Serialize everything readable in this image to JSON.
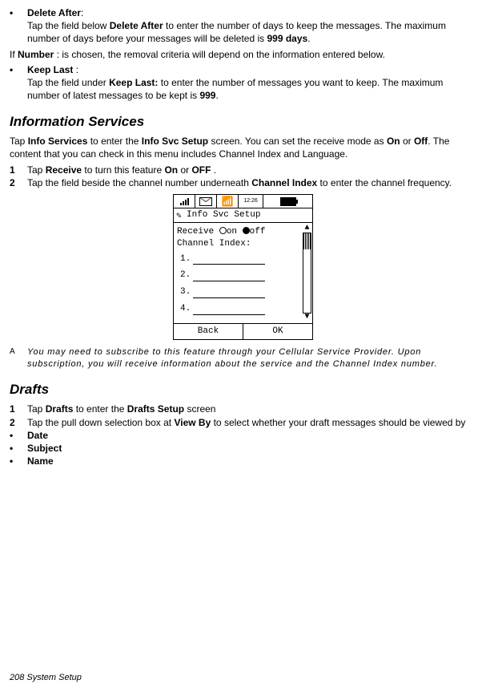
{
  "s1": {
    "deleteAfter": {
      "label": "Delete After",
      "body_a": "Tap the field below ",
      "body_b": "Delete After",
      "body_c": " to enter the number of days to keep the messages. The maximum number of days before your messages will be deleted is ",
      "limit": "999 days",
      "body_d": "."
    },
    "ifNumber_a": "If ",
    "ifNumber_b": "Number",
    "ifNumber_c": " : is chosen, the removal criteria will depend on the information entered below.",
    "keepLast": {
      "label": "Keep Last",
      "body_a": "Tap the field under ",
      "body_b": "Keep Last:",
      "body_c": " to enter the number of messages you want to keep. The maximum number of latest messages to be kept is ",
      "limit": "999",
      "body_d": "."
    }
  },
  "info": {
    "heading": "Information Services",
    "intro_a": "Tap ",
    "intro_b": "Info Services",
    "intro_c": " to enter the ",
    "intro_d": "Info Svc Setup",
    "intro_e": " screen. You can set the receive mode as ",
    "intro_f": "On",
    "intro_g": " or ",
    "intro_h": "Off",
    "intro_i": ". The content that you can check in this menu includes Channel Index and Language.",
    "step1_a": "Tap ",
    "step1_b": "Receive",
    "step1_c": " to turn this feature ",
    "step1_d": "On",
    "step1_e": " or ",
    "step1_f": "OFF",
    "step1_g": " .",
    "step2_a": "Tap the field beside the channel number underneath ",
    "step2_b": "Channel Index",
    "step2_c": " to enter the channel frequency.",
    "note_letter": "A",
    "note_text": "You may need to subscribe to this feature through your Cellular Service Provider. Upon subscription, you will receive information about the service and the Channel Index number."
  },
  "phone": {
    "time": "12:26",
    "title": "Info Svc Setup",
    "receive_label": "Receive",
    "receive_on": "on",
    "receive_off": "off",
    "channel_label": "Channel Index:",
    "lines": [
      "1.",
      "2.",
      "3.",
      "4."
    ],
    "back": "Back",
    "ok": "OK"
  },
  "drafts": {
    "heading": "Drafts",
    "step1_a": "Tap ",
    "step1_b": "Drafts",
    "step1_c": " to enter the ",
    "step1_d": "Drafts Setup",
    "step1_e": " screen",
    "step2_a": "Tap the pull down selection box at ",
    "step2_b": "View By",
    "step2_c": " to select whether your draft messages should be viewed by",
    "b1": "Date",
    "b2": "Subject",
    "b3": "Name"
  },
  "footer": "208   System Setup"
}
